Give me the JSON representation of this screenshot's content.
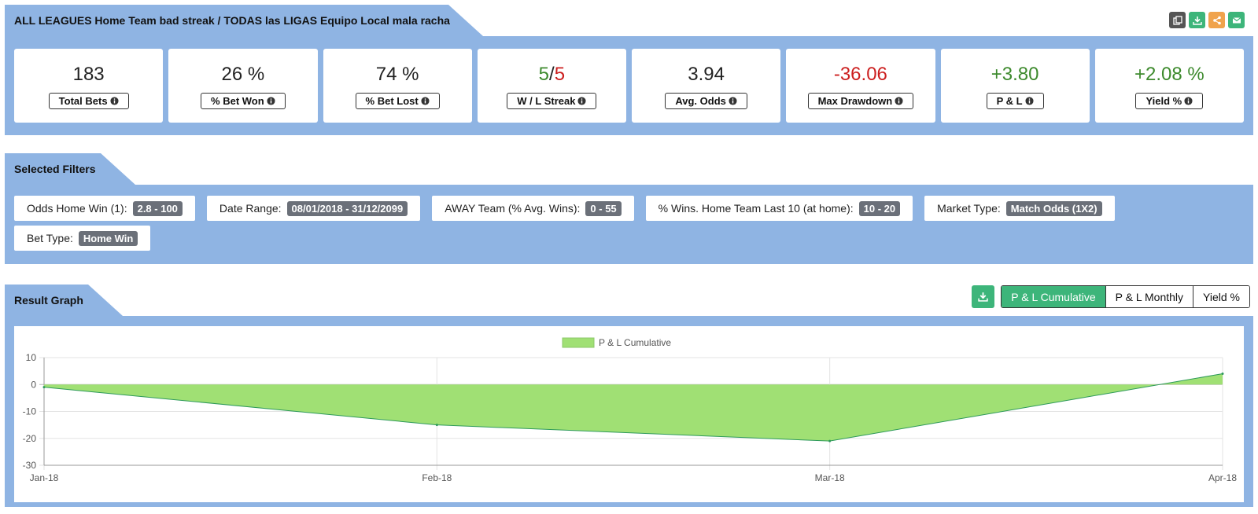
{
  "header": {
    "title": "ALL LEAGUES Home Team bad streak / TODAS las LIGAS Equipo Local mala racha",
    "icons": [
      "copy-icon",
      "download-icon",
      "share-icon",
      "email-icon"
    ]
  },
  "stats": [
    {
      "key": "total_bets",
      "value": "183",
      "label": "Total Bets"
    },
    {
      "key": "pct_won",
      "value": "26 %",
      "label": "% Bet Won"
    },
    {
      "key": "pct_lost",
      "value": "74 %",
      "label": "% Bet Lost"
    },
    {
      "key": "streak",
      "value_w": "5",
      "value_sep": "/",
      "value_l": "5",
      "label": "W / L Streak"
    },
    {
      "key": "avg_odds",
      "value": "3.94",
      "label": "Avg. Odds"
    },
    {
      "key": "max_dd",
      "value": "-36.06",
      "label": "Max Drawdown"
    },
    {
      "key": "pl",
      "value": "+3.80",
      "label": "P & L"
    },
    {
      "key": "yield",
      "value": "+2.08 %",
      "label": "Yield %"
    }
  ],
  "colors": {
    "panel": "#8fb4e3",
    "positive": "#3d8a2d",
    "negative": "#cc1f1f",
    "accent": "#3db57a",
    "area_fill": "#a0e074",
    "area_line": "#2e9a5a"
  },
  "filters": {
    "title": "Selected Filters",
    "items": [
      {
        "label": "Odds Home Win (1):",
        "value": "2.8 - 100"
      },
      {
        "label": "Date Range:",
        "value": "08/01/2018 - 31/12/2099"
      },
      {
        "label": "AWAY Team (% Avg. Wins):",
        "value": "0 - 55"
      },
      {
        "label": "% Wins. Home Team Last 10 (at home):",
        "value": "10 - 20"
      },
      {
        "label": "Market Type:",
        "value": "Match Odds (1X2)"
      },
      {
        "label": "Bet Type:",
        "value": "Home Win"
      }
    ]
  },
  "graph": {
    "title": "Result Graph",
    "tabs": [
      "P & L Cumulative",
      "P & L Monthly",
      "Yield %"
    ],
    "active_tab": 0
  },
  "chart_data": {
    "type": "area",
    "legend": "P & L Cumulative",
    "legend_position": "top-center",
    "x": [
      "Jan-18",
      "Feb-18",
      "Mar-18",
      "Apr-18"
    ],
    "series": [
      {
        "name": "P & L Cumulative",
        "values": [
          -1,
          -15,
          -21,
          4
        ]
      }
    ],
    "ylim": [
      -30,
      10
    ],
    "yticks": [
      10,
      0,
      -10,
      -20,
      -30
    ],
    "grid": true
  }
}
